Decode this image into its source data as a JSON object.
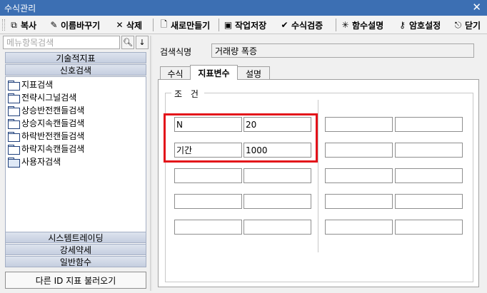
{
  "window": {
    "title": "수식관리"
  },
  "toolbar": {
    "items": [
      {
        "label": "복사",
        "icon": "copy-icon"
      },
      {
        "label": "이름바꾸기",
        "icon": "rename-icon"
      },
      {
        "label": "삭제",
        "icon": "delete-x-icon"
      },
      {
        "label": "새로만들기",
        "icon": "new-document-icon"
      },
      {
        "label": "작업저장",
        "icon": "save-disk-icon"
      },
      {
        "label": "수식검증",
        "icon": "checkmark-icon"
      },
      {
        "label": "함수설명",
        "icon": "magic-wand-icon"
      },
      {
        "label": "암호설정",
        "icon": "key-icon"
      },
      {
        "label": "닫기",
        "icon": "close-door-icon"
      }
    ]
  },
  "sidebar": {
    "search": {
      "placeholder": "메뉴항목검색",
      "value": ""
    },
    "top_categories": [
      "기술적지표",
      "신호검색"
    ],
    "tree_items": [
      "지표검색",
      "전략시그널검색",
      "상승반전캔들검색",
      "상승지속캔들검색",
      "하락반전캔들검색",
      "하락지속캔들검색",
      "사용자검색"
    ],
    "bottom_categories": [
      "시스템트레이딩",
      "강세약세",
      "일반함수"
    ],
    "load_button": "다른 ID 지표 불러오기"
  },
  "main": {
    "name_label": "검색식명",
    "name_value": "거래량 폭증",
    "tabs": [
      {
        "label": "수식",
        "active": false
      },
      {
        "label": "지표변수",
        "active": true
      },
      {
        "label": "설명",
        "active": false
      }
    ],
    "group_title": "조 건",
    "variables": [
      {
        "name": "N",
        "value": "20"
      },
      {
        "name": "기간",
        "value": "1000"
      },
      {
        "name": "",
        "value": ""
      },
      {
        "name": "",
        "value": ""
      },
      {
        "name": "",
        "value": ""
      },
      {
        "name": "",
        "value": ""
      },
      {
        "name": "",
        "value": ""
      },
      {
        "name": "",
        "value": ""
      },
      {
        "name": "",
        "value": ""
      },
      {
        "name": "",
        "value": ""
      }
    ]
  },
  "colors": {
    "titlebar": "#3c6fb3",
    "category_button": "#c5cee0",
    "highlight_box": "#e3121a"
  }
}
